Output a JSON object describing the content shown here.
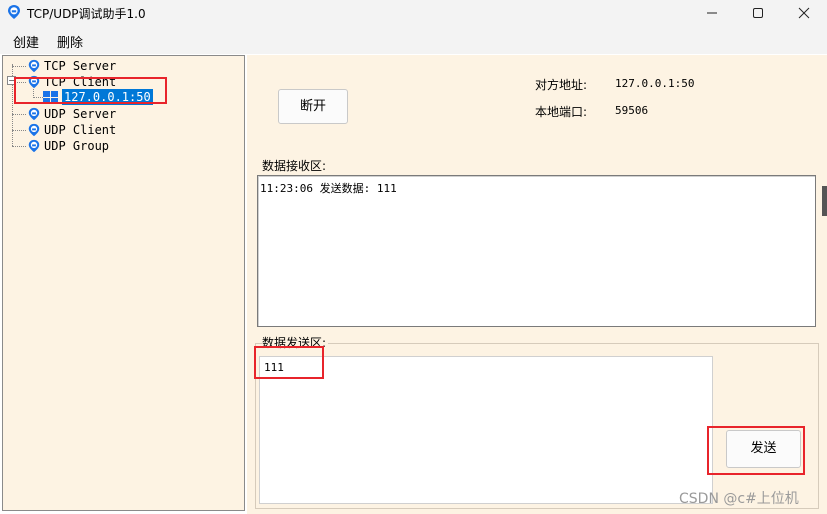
{
  "window": {
    "title": "TCP/UDP调试助手1.0",
    "icon": "phone-pin-icon"
  },
  "menu": {
    "create_label": "创建",
    "delete_label": "删除"
  },
  "tree": {
    "nodes": [
      {
        "label": "TCP Server",
        "icon": "phone-pin-icon"
      },
      {
        "label": "TCP Client",
        "icon": "phone-pin-icon",
        "expanded": true
      },
      {
        "label": "UDP Server",
        "icon": "phone-pin-icon"
      },
      {
        "label": "UDP Client",
        "icon": "phone-pin-icon"
      },
      {
        "label": "UDP Group",
        "icon": "phone-pin-icon"
      }
    ],
    "selected_child": {
      "label": "127.0.0.1:50",
      "icon": "windows-icon"
    }
  },
  "connection": {
    "disconnect_label": "断开",
    "remote_addr_label": "对方地址:",
    "remote_addr_value": "127.0.0.1:50",
    "local_port_label": "本地端口:",
    "local_port_value": "59506"
  },
  "receive": {
    "group_label": "数据接收区:",
    "content": "11:23:06 发送数据: 111"
  },
  "send": {
    "group_label": "数据发送区:",
    "content": "111",
    "send_label": "发送"
  },
  "watermark": "CSDN @c#上位机",
  "colors": {
    "panel_bg": "#fdf3e3",
    "selection": "#0078d7",
    "highlight_box": "#e8242b",
    "node_icon": "#1a73e8"
  }
}
